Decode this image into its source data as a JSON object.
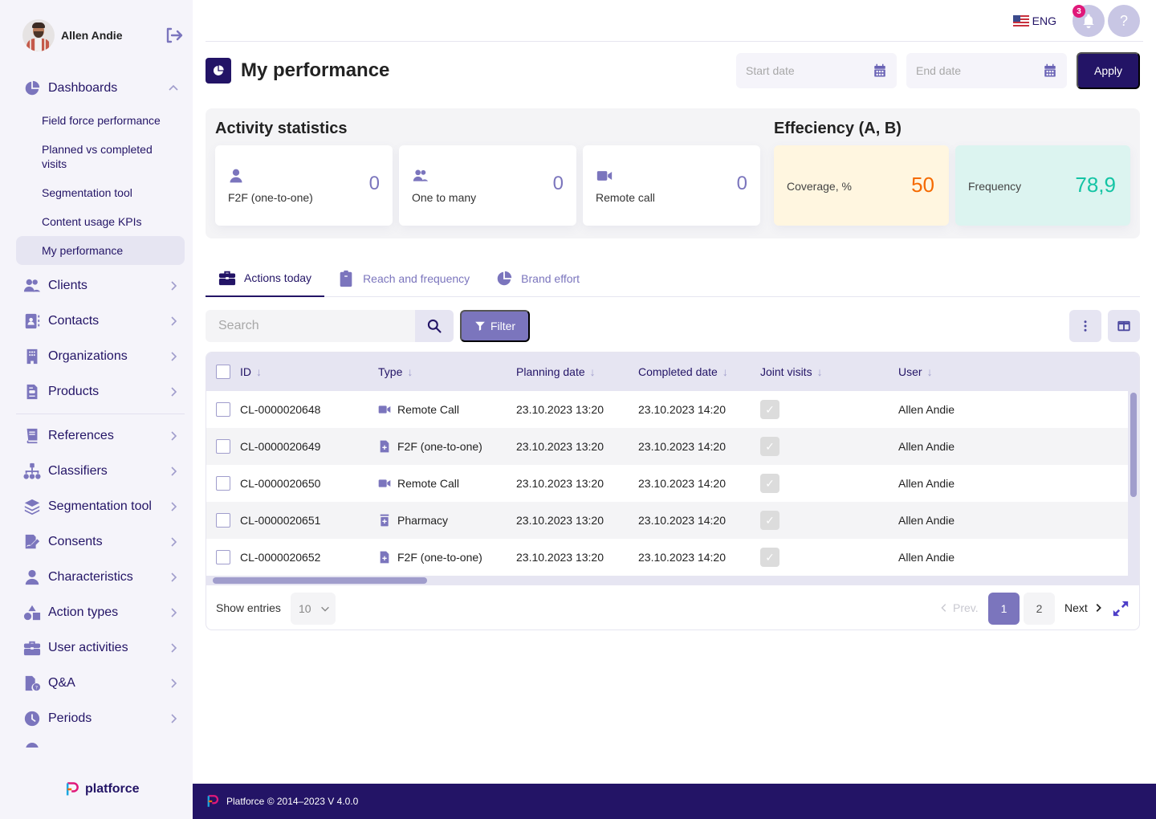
{
  "user": {
    "name": "Allen Andie"
  },
  "sidebar": {
    "dashboards": {
      "label": "Dashboards",
      "subitems": [
        {
          "label": "Field force performance"
        },
        {
          "label": "Planned vs completed visits"
        },
        {
          "label": "Segmentation tool"
        },
        {
          "label": "Content usage KPIs"
        },
        {
          "label": "My performance",
          "active": true
        }
      ]
    },
    "items": [
      {
        "label": "Clients",
        "icon": "users-icon"
      },
      {
        "label": "Contacts",
        "icon": "contact-book-icon"
      },
      {
        "label": "Organizations",
        "icon": "building-icon"
      },
      {
        "label": "Products",
        "icon": "product-doc-icon"
      },
      {
        "label": "References",
        "icon": "book-icon"
      },
      {
        "label": "Classifiers",
        "icon": "sitemap-icon"
      },
      {
        "label": "Segmentation tool",
        "icon": "layers-icon"
      },
      {
        "label": "Consents",
        "icon": "signature-icon"
      },
      {
        "label": "Characteristics",
        "icon": "user-icon"
      },
      {
        "label": "Action types",
        "icon": "shapes-icon"
      },
      {
        "label": "User activities",
        "icon": "briefcase-icon"
      },
      {
        "label": "Q&A",
        "icon": "file-question-icon"
      },
      {
        "label": "Periods",
        "icon": "clock-icon"
      }
    ],
    "logo_text": "platforce"
  },
  "topbar": {
    "language": "ENG",
    "notifications_count": "3",
    "help_label": "?"
  },
  "page": {
    "title": "My performance",
    "start_date_placeholder": "Start date",
    "end_date_placeholder": "End date",
    "apply_label": "Apply"
  },
  "activity": {
    "title": "Activity statistics",
    "cards": [
      {
        "label": "F2F (one-to-one)",
        "value": "0",
        "icon": "user-icon"
      },
      {
        "label": "One to many",
        "value": "0",
        "icon": "users-icon"
      },
      {
        "label": "Remote call",
        "value": "0",
        "icon": "video-icon"
      }
    ]
  },
  "efficiency": {
    "title": "Effeciency (A, B)",
    "cards": [
      {
        "label": "Coverage, %",
        "value": "50",
        "bg": "#fff6e0",
        "color": "#f56a00"
      },
      {
        "label": "Frequency",
        "value": "78,9",
        "bg": "#dcf4f0",
        "color": "#14c4a4"
      }
    ]
  },
  "tabs": [
    {
      "label": "Actions today",
      "active": true
    },
    {
      "label": "Reach and frequency"
    },
    {
      "label": "Brand effort"
    }
  ],
  "toolbar": {
    "search_placeholder": "Search",
    "filter_label": "Filter"
  },
  "table": {
    "columns": [
      "ID",
      "Type",
      "Planning date",
      "Completed date",
      "Joint visits",
      "User"
    ],
    "rows": [
      {
        "id": "CL-0000020648",
        "type": "Remote Call",
        "type_icon": "video-icon",
        "planning": "23.10.2023 13:20",
        "completed": "23.10.2023 14:20",
        "joint": true,
        "user": "Allen Andie"
      },
      {
        "id": "CL-0000020649",
        "type": "F2F (one-to-one)",
        "type_icon": "file-plus-icon",
        "planning": "23.10.2023 13:20",
        "completed": "23.10.2023 14:20",
        "joint": true,
        "user": "Allen Andie"
      },
      {
        "id": "CL-0000020650",
        "type": "Remote Call",
        "type_icon": "video-icon",
        "planning": "23.10.2023 13:20",
        "completed": "23.10.2023 14:20",
        "joint": true,
        "user": "Allen Andie"
      },
      {
        "id": "CL-0000020651",
        "type": "Pharmacy",
        "type_icon": "pharmacy-icon",
        "planning": "23.10.2023 13:20",
        "completed": "23.10.2023 14:20",
        "joint": true,
        "user": "Allen Andie"
      },
      {
        "id": "CL-0000020652",
        "type": "F2F (one-to-one)",
        "type_icon": "file-plus-icon",
        "planning": "23.10.2023 13:20",
        "completed": "23.10.2023 14:20",
        "joint": true,
        "user": "Allen Andie"
      }
    ],
    "footer": {
      "show_entries_label": "Show entries",
      "entries_value": "10",
      "prev_label": "Prev.",
      "pages": [
        "1",
        "2"
      ],
      "current_page": "1",
      "next_label": "Next"
    }
  },
  "footer": {
    "text": "Platforce © 2014–2023 V 4.0.0"
  }
}
